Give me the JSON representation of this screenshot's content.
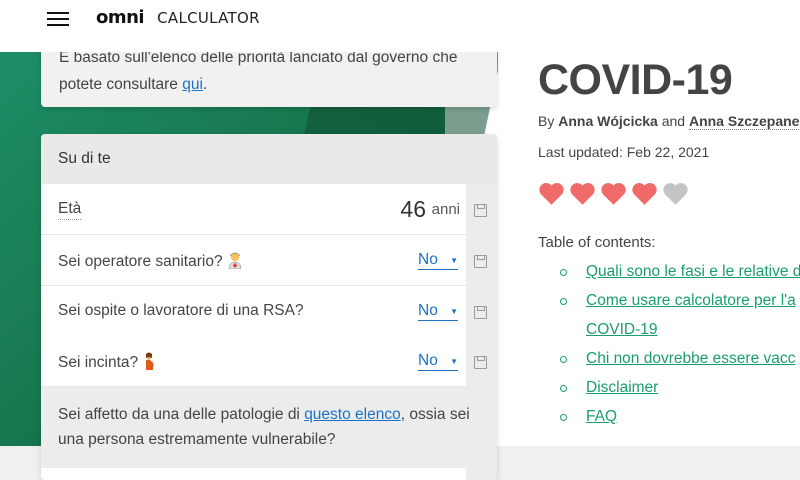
{
  "header": {
    "logo_omni": "omni",
    "logo_calculator": "CALCULATOR"
  },
  "top_card": {
    "line1": "È basato sull'elenco delle priorità lanciato dal governo che",
    "line2_prefix": "potete consultare ",
    "link": "qui",
    "line2_suffix": "."
  },
  "form": {
    "section_title": "Su di te",
    "fields": [
      {
        "label": "Età",
        "value": "46",
        "unit": "anni"
      },
      {
        "label": "Sei operatore sanitario?",
        "value": "No"
      },
      {
        "label": "Sei ospite o lavoratore di una RSA?",
        "value": "No"
      },
      {
        "label": "Sei incinta?",
        "value": "No"
      }
    ],
    "question_prefix": "Sei affetto da una delle patologie di ",
    "question_link": "questo elenco",
    "question_suffix": ", ossia sei una persona estremamente vulnerabile?"
  },
  "article": {
    "title": "COVID-19",
    "by": "By",
    "author1": "Anna Wójcicka",
    "and": "and",
    "author2": "Anna Szczepanek",
    "updated": "Last updated: Feb 22, 2021",
    "rating": {
      "filled": 4,
      "total": 5
    },
    "colors": {
      "heart_filled": "#f06a6a",
      "heart_empty": "#c4c4c4",
      "accent_green": "#1a9e6b",
      "link_blue": "#1a73c7"
    },
    "toc_title": "Table of contents:",
    "toc": [
      "Quali sono le fasi e le relative d",
      "Come usare calcolatore per l'a",
      "COVID-19",
      "Chi non dovrebbe essere vacc",
      "Disclaimer",
      "FAQ"
    ]
  }
}
